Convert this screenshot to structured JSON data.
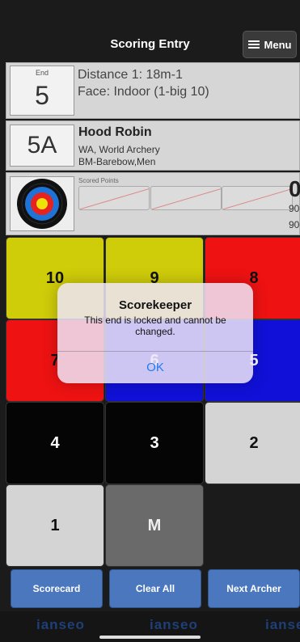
{
  "header": {
    "title": "Scoring Entry",
    "menu_label": "Menu"
  },
  "end_info": {
    "label": "End",
    "number": "5",
    "distance": "Distance 1: 18m-1",
    "face": "Face: Indoor (1-big 10)"
  },
  "archer": {
    "target_code": "5A",
    "name": "Hood Robin",
    "organization": "WA, World Archery",
    "classification": "BM-Barebow,Men"
  },
  "score": {
    "label": "Scored Points",
    "end_total": "0",
    "running_total_1": "90",
    "running_total_2": "90"
  },
  "keypad": [
    {
      "label": "10",
      "color": "#cfcc0a",
      "text": "#111111"
    },
    {
      "label": "9",
      "color": "#cfcc0a",
      "text": "#111111"
    },
    {
      "label": "8",
      "color": "#ee1212",
      "text": "#111111"
    },
    {
      "label": "7",
      "color": "#ee1212",
      "text": "#111111"
    },
    {
      "label": "6",
      "color": "#1010d8",
      "text": "#ffffff"
    },
    {
      "label": "5",
      "color": "#1010d8",
      "text": "#ffffff"
    },
    {
      "label": "4",
      "color": "#050505",
      "text": "#ffffff"
    },
    {
      "label": "3",
      "color": "#050505",
      "text": "#ffffff"
    },
    {
      "label": "2",
      "color": "#d4d4d4",
      "text": "#111111"
    },
    {
      "label": "1",
      "color": "#d4d4d4",
      "text": "#111111"
    },
    {
      "label": "M",
      "color": "#6a6a6a",
      "text": "#eeeeee"
    }
  ],
  "actions": {
    "scorecard": "Scorecard",
    "clear_all": "Clear All",
    "next_archer": "Next Archer"
  },
  "footer": {
    "logo": "ianseo"
  },
  "alert": {
    "title": "Scorekeeper",
    "message": "This end is locked and cannot be changed.",
    "ok": "OK"
  },
  "colors": {
    "accent": "#4a77bd",
    "alert_link": "#1e7cf3"
  }
}
